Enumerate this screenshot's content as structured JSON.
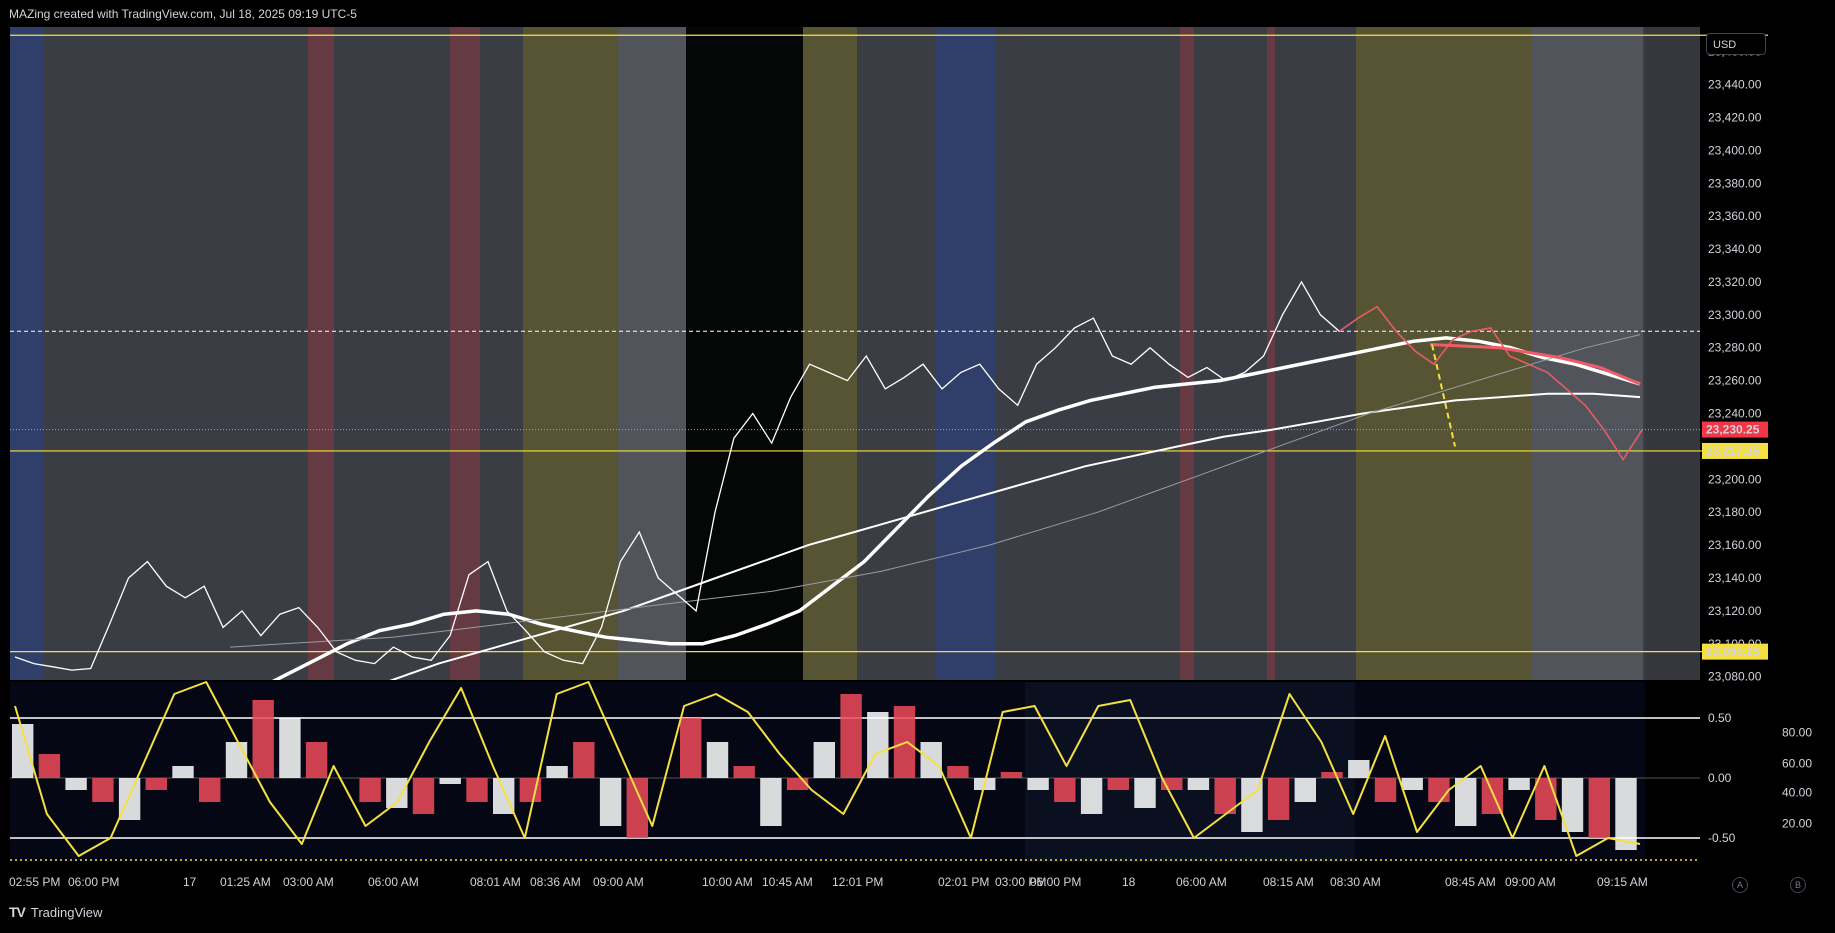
{
  "header": {
    "title": "MAZing created with TradingView.com, Jul 18, 2025 09:19 UTC-5"
  },
  "footer": {
    "brand": "TradingView",
    "logo_icon": "tradingview-logo-icon"
  },
  "currency_button": "USD",
  "scale_buttons": [
    "A",
    "B"
  ],
  "colors": {
    "background": "#000000",
    "session_gray": "#3b3d44",
    "session_light": "#55575e",
    "session_red": "#6b3a44",
    "session_yellow": "#5a5632",
    "session_blue": "#2f3f6e",
    "level_line": "#f5e042",
    "price_white": "#ffffff",
    "price_red": "#f04a5a",
    "ma_red": "#f05a6a",
    "osc_yellow": "#f5e042"
  },
  "chart_data": [
    {
      "type": "line",
      "name": "price",
      "x_ticks": [
        "02:55 PM",
        "06:00 PM",
        "17",
        "01:25 AM",
        "03:00 AM",
        "06:00 AM",
        "08:01 AM",
        "08:36 AM",
        "09:00 AM",
        "10:00 AM",
        "10:45 AM",
        "12:01 PM",
        "02:01 PM",
        "03:00 PM",
        "06:00 PM",
        "18",
        "06:00 AM",
        "08:15 AM",
        "08:30 AM",
        "08:45 AM",
        "09:00 AM",
        "09:15 AM"
      ],
      "y_ticks": [
        "23,460.00",
        "23,440.00",
        "23,420.00",
        "23,400.00",
        "23,380.00",
        "23,360.00",
        "23,340.00",
        "23,320.00",
        "23,300.00",
        "23,280.00",
        "23,260.00",
        "23,240.00",
        "23,200.00",
        "23,180.00",
        "23,160.00",
        "23,140.00",
        "23,120.00",
        "23,100.00",
        "23,080.00"
      ],
      "ylim": [
        23078,
        23475
      ],
      "current_price_label": "23,230.25",
      "level_labels": [
        "23,217.25",
        "23,095.25"
      ],
      "levels": [
        23470,
        23217.25,
        23095.25
      ],
      "dashed_level": 23290,
      "dotted_level": 23230.25,
      "price": [
        23092,
        23088,
        23086,
        23084,
        23085,
        23112,
        23140,
        23150,
        23135,
        23128,
        23135,
        23110,
        23120,
        23105,
        23118,
        23122,
        23110,
        23095,
        23090,
        23088,
        23098,
        23092,
        23090,
        23105,
        23142,
        23150,
        23120,
        23108,
        23095,
        23090,
        23088,
        23110,
        23150,
        23168,
        23140,
        23130,
        23120,
        23180,
        23225,
        23240,
        23222,
        23250,
        23270,
        23265,
        23260,
        23275,
        23255,
        23262,
        23270,
        23255,
        23265,
        23270,
        23255,
        23245,
        23270,
        23280,
        23292,
        23298,
        23275,
        23270,
        23280,
        23270,
        23262,
        23268,
        23260,
        23265,
        23275,
        23300,
        23320,
        23300,
        23290,
        23298,
        23305,
        23290,
        23278,
        23270,
        23285,
        23290,
        23292,
        23275,
        23270,
        23265,
        23255,
        23245,
        23230,
        23212,
        23230
      ],
      "ma_fast": [
        23070,
        23080,
        23090,
        23100,
        23108,
        23112,
        23118,
        23120,
        23118,
        23112,
        23108,
        23104,
        23102,
        23100,
        23100,
        23105,
        23112,
        23120,
        23135,
        23150,
        23170,
        23190,
        23208,
        23222,
        23235,
        23242,
        23248,
        23252,
        23256,
        23258,
        23260,
        23264,
        23268,
        23272,
        23276,
        23280,
        23284,
        23286,
        23284,
        23280,
        23274,
        23270,
        23264,
        23258
      ],
      "ma_slow": [
        23068,
        23070,
        23072,
        23074,
        23078,
        23082,
        23086,
        23090,
        23094,
        23098,
        23102,
        23108,
        23114,
        23122,
        23130,
        23140,
        23150,
        23162,
        23174,
        23186,
        23198,
        23210,
        23220,
        23230,
        23240,
        23250,
        23258
      ],
      "ma_mid": [
        23060,
        23068,
        23078,
        23088,
        23096,
        23104,
        23112,
        23120,
        23130,
        23140,
        23150,
        23160,
        23168,
        23176,
        23184,
        23192,
        23200,
        23208,
        23214,
        23220,
        23226,
        23230,
        23235,
        23240,
        23244,
        23248,
        23250,
        23252,
        23252,
        23250
      ]
    },
    {
      "type": "bar",
      "name": "oscillator",
      "y_ticks_left": [
        "0.50",
        "0.00",
        "-0.50"
      ],
      "y_ticks_right": [
        "80.00",
        "60.00",
        "40.00",
        "20.00"
      ],
      "ylim": [
        -0.7,
        0.8
      ],
      "histogram": [
        0.45,
        0.2,
        -0.1,
        -0.2,
        -0.35,
        -0.1,
        0.1,
        -0.2,
        0.3,
        0.65,
        0.5,
        0.3,
        0.0,
        -0.2,
        -0.25,
        -0.3,
        -0.05,
        -0.2,
        -0.3,
        -0.2,
        0.1,
        0.3,
        -0.4,
        -0.5,
        0.0,
        0.5,
        0.3,
        0.1,
        -0.4,
        -0.1,
        0.3,
        0.7,
        0.55,
        0.6,
        0.3,
        0.1,
        -0.1,
        0.05,
        -0.1,
        -0.2,
        -0.3,
        -0.1,
        -0.25,
        -0.1,
        -0.1,
        -0.3,
        -0.45,
        -0.35,
        -0.2,
        0.05,
        0.15,
        -0.2,
        -0.1,
        -0.2,
        -0.4,
        -0.3,
        -0.1,
        -0.35,
        -0.45,
        -0.5,
        -0.6
      ],
      "signal": [
        0.6,
        -0.3,
        -0.65,
        -0.5,
        0.1,
        0.7,
        0.8,
        0.3,
        -0.2,
        -0.55,
        0.1,
        -0.4,
        -0.2,
        0.3,
        0.75,
        0.1,
        -0.5,
        0.7,
        0.8,
        0.2,
        -0.4,
        0.6,
        0.7,
        0.55,
        0.2,
        -0.1,
        -0.3,
        0.2,
        0.3,
        0.1,
        -0.5,
        0.55,
        0.6,
        0.1,
        0.6,
        0.65,
        0.0,
        -0.5,
        -0.3,
        -0.1,
        0.7,
        0.3,
        -0.3,
        0.35,
        -0.45,
        -0.1,
        0.1,
        -0.5,
        0.1,
        -0.65,
        -0.5,
        -0.55
      ]
    }
  ]
}
